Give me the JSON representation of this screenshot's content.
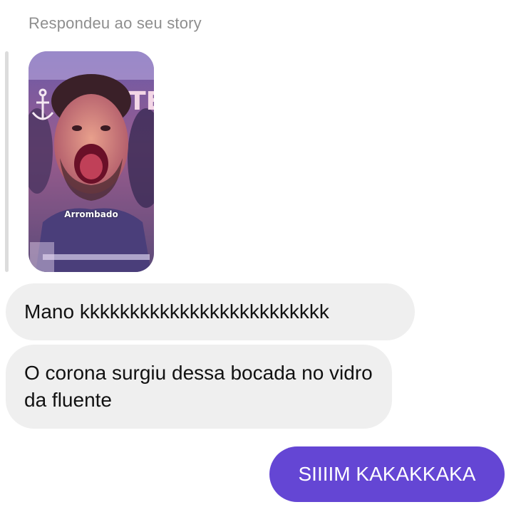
{
  "conversation": {
    "reply_context": "Respondeu ao seu story",
    "story": {
      "caption": "Arrombado",
      "sign_text": "NTE"
    },
    "messages": [
      {
        "direction": "incoming",
        "text": "Mano kkkkkkkkkkkkkkkkkkkkkkkkk"
      },
      {
        "direction": "incoming",
        "text": "O corona surgiu dessa bocada no vidro da fluente"
      },
      {
        "direction": "outgoing",
        "text": "SIIIIM KAKAKKAKA"
      }
    ]
  },
  "colors": {
    "incoming_bubble": "#efefef",
    "outgoing_bubble": "#6446d4",
    "reply_label": "#8e8e8e",
    "reply_bar": "#dcdcdc"
  },
  "icons": [
    "anchor-icon"
  ]
}
